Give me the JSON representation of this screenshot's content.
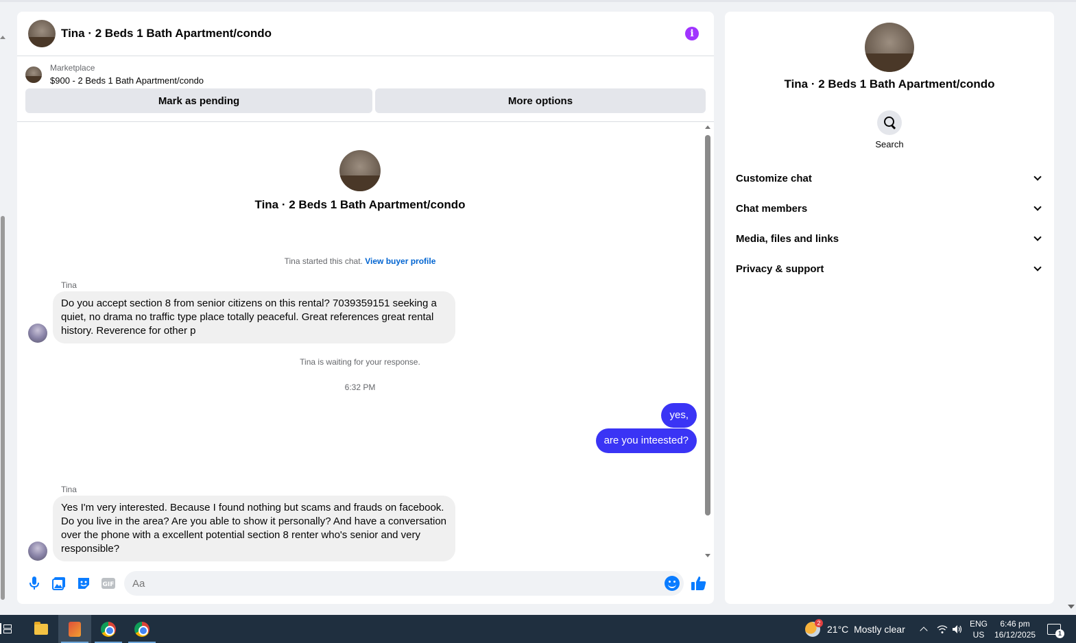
{
  "chat": {
    "header_title": "Tina · 2 Beds 1 Bath Apartment/condo",
    "marketplace_label": "Marketplace",
    "listing": "$900 - 2 Beds 1 Bath Apartment/condo",
    "mark_pending": "Mark as pending",
    "more_options": "More options",
    "intro_title": "Tina · 2 Beds 1 Bath Apartment/condo",
    "started_text": "Tina started this chat.",
    "view_buyer": "View buyer profile",
    "messages": [
      {
        "sender": "Tina",
        "text": "Do you accept section 8 from senior citizens on this rental? 7039359151 seeking a quiet, no drama no traffic type place totally peaceful. Great references great rental history. Reverence for other p"
      },
      {
        "sender": "Tina",
        "text": "Yes I'm very interested. Because I found nothing but scams and frauds on facebook. Do you live in the area? Are you able to show it personally? And have a conversation over the phone with a excellent potential section 8 renter who's senior and very responsible?"
      }
    ],
    "waiting_text": "Tina is waiting for your response.",
    "time": "6:32 PM",
    "outgoing": [
      "yes,",
      "are you inteested?"
    ],
    "input_placeholder": "Aa"
  },
  "side": {
    "title": "Tina · 2 Beds 1 Bath Apartment/condo",
    "search_label": "Search",
    "menu": [
      "Customize chat",
      "Chat members",
      "Media, files and links",
      "Privacy & support"
    ]
  },
  "taskbar": {
    "weather_badge": "2",
    "temperature": "21°C",
    "condition": "Mostly clear",
    "lang": "ENG",
    "region": "US",
    "time": "6:46 pm",
    "date": "16/12/2025",
    "notif_count": "1"
  },
  "colors": {
    "accent": "#0a7cff",
    "outgoing_bubble": "#3a34f5",
    "info": "#a033ff"
  }
}
